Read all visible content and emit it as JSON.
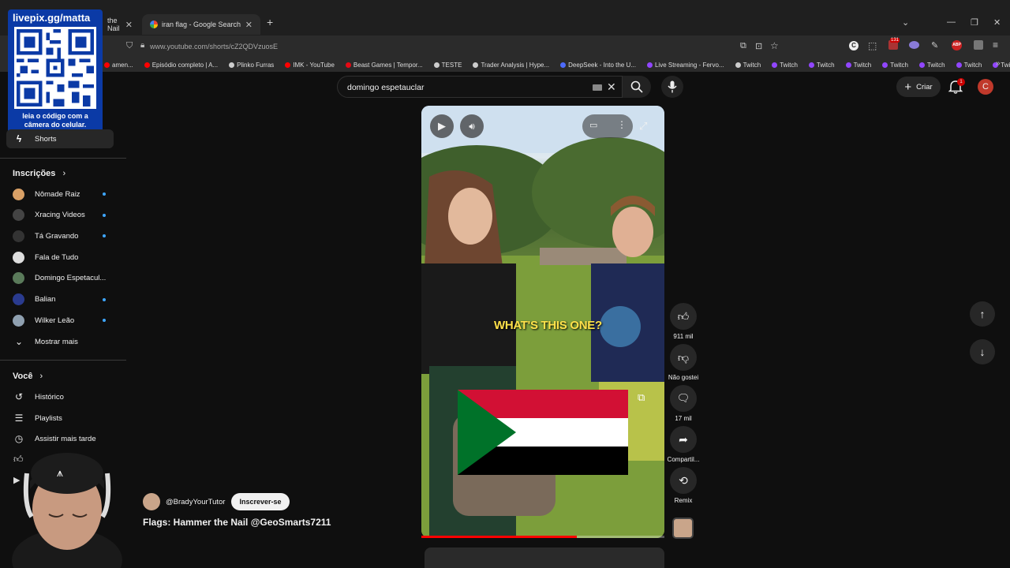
{
  "browser": {
    "tabs": [
      {
        "label": "the Nail",
        "active": false
      },
      {
        "label": "iran flag - Google Search",
        "active": true
      }
    ],
    "url": "www.youtube.com/shorts/cZ2QDVzuosE",
    "ext_badge": "131",
    "bookmarks": [
      {
        "label": "amen...",
        "color": "#ff0000"
      },
      {
        "label": "Episódio completo | A...",
        "color": "#ff0000"
      },
      {
        "label": "Plinko Furras",
        "color": "#cccccc"
      },
      {
        "label": "IMK - YouTube",
        "color": "#ff0000"
      },
      {
        "label": "Beast Games | Tempor...",
        "color": "#e50914"
      },
      {
        "label": "TESTE",
        "color": "#cccccc"
      },
      {
        "label": "Trader Analysis | Hype...",
        "color": "#cccccc"
      },
      {
        "label": "DeepSeek - Into the U...",
        "color": "#4d6bfe"
      },
      {
        "label": "Live Streaming - Fervo...",
        "color": "#9146ff"
      },
      {
        "label": "Twitch",
        "color": "#cccccc"
      },
      {
        "label": "Twitch",
        "color": "#9146ff"
      },
      {
        "label": "Twitch",
        "color": "#9146ff"
      },
      {
        "label": "Twitch",
        "color": "#9146ff"
      },
      {
        "label": "Twitch",
        "color": "#9146ff"
      },
      {
        "label": "Twitch",
        "color": "#9146ff"
      },
      {
        "label": "Twitch",
        "color": "#9146ff"
      },
      {
        "label": "Twitch",
        "color": "#9146ff"
      }
    ]
  },
  "qr_overlay": {
    "title": "livepix.gg/matta",
    "caption": "leia o código com a câmera do celular."
  },
  "sidebar": {
    "shorts": "Shorts",
    "subs_header": "Inscrições",
    "subscriptions": [
      {
        "label": "Nômade Raiz",
        "color": "#d9a066",
        "live": true
      },
      {
        "label": "Xracing Videos",
        "color": "#444444",
        "live": true
      },
      {
        "label": "Tá Gravando",
        "color": "#333333",
        "live": true
      },
      {
        "label": "Fala de Tudo",
        "color": "#dddddd",
        "live": false
      },
      {
        "label": "Domingo Espetacul...",
        "color": "#5a7a5a",
        "live": false
      },
      {
        "label": "Balian",
        "color": "#2a3b8f",
        "live": true
      },
      {
        "label": "Wilker Leão",
        "color": "#8fa0b0",
        "live": true
      }
    ],
    "show_more": "Mostrar mais",
    "you_header": "Você",
    "you_items": [
      {
        "label": "Histórico",
        "icon": "history-icon"
      },
      {
        "label": "Playlists",
        "icon": "playlists-icon"
      },
      {
        "label": "Assistir mais tarde",
        "icon": "watch-later-icon"
      }
    ]
  },
  "topbar": {
    "search_value": "domingo espetauclar",
    "create_label": "Criar",
    "notif_count": "1",
    "avatar_letter": "C"
  },
  "short": {
    "overlay_text": "WHAT'S THIS ONE?",
    "progress": 0.64,
    "flag_colors": {
      "red": "#d21034",
      "white": "#ffffff",
      "black": "#000000",
      "green": "#007229"
    },
    "channel": "@BradyYourTutor",
    "subscribe_label": "Inscrever-se",
    "title": "Flags: Hammer the Nail @GeoSmarts7211"
  },
  "actions": {
    "likes": "911 mil",
    "dislike": "Não gostei",
    "comments": "17 mil",
    "share": "Compartil...",
    "remix": "Remix"
  }
}
